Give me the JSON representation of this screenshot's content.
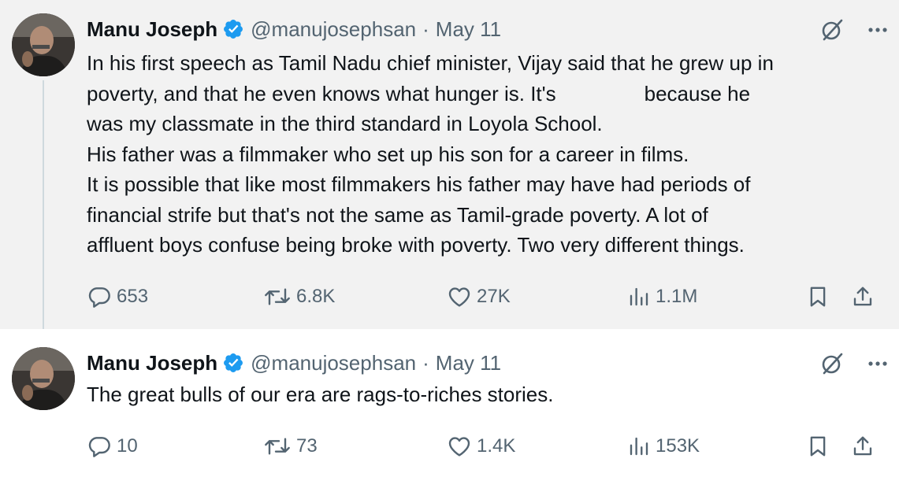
{
  "tweets": [
    {
      "author": {
        "name": "Manu Joseph",
        "handle": "@manujosephsan",
        "separator": "·",
        "date": "May 11"
      },
      "text_lines": [
        "In his first speech as Tamil Nadu chief minister, Vijay said that he grew up in",
        "poverty, and that he even knows what hunger is. It's",
        "because he",
        "was my classmate in the third standard in Loyola School.",
        "His father was a filmmaker who set up his son for a career in films.",
        "It is possible that like most filmmakers his father may have had periods of",
        "financial strife but that's not the same as Tamil-grade poverty. A lot of",
        "affluent boys confuse being broke with poverty. Two very different things."
      ],
      "stats": {
        "replies": "653",
        "reposts": "6.8K",
        "likes": "27K",
        "views": "1.1M"
      }
    },
    {
      "author": {
        "name": "Manu Joseph",
        "handle": "@manujosephsan",
        "separator": "·",
        "date": "May 11"
      },
      "text_lines": [
        "The great bulls of our era are rags-to-riches stories."
      ],
      "stats": {
        "replies": "10",
        "reposts": "73",
        "likes": "1.4K",
        "views": "153K"
      }
    }
  ],
  "icons": {
    "verified": "verified-badge-icon",
    "grok": "grok-icon",
    "more": "more-icon",
    "reply": "reply-icon",
    "repost": "repost-icon",
    "like": "like-icon",
    "views": "views-icon",
    "bookmark": "bookmark-icon",
    "share": "share-icon"
  },
  "colors": {
    "verified": "#1d9bf0",
    "secondary_text": "#536471",
    "primary_text": "#0f1419",
    "thread_line": "#cfd9de",
    "highlight_bg": "#f2f2f2"
  }
}
